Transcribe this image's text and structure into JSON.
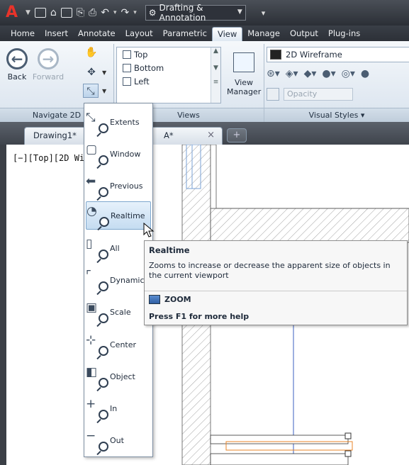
{
  "quick_access": {
    "workspace": "Drafting & Annotation"
  },
  "ribbon_tabs": [
    "Home",
    "Insert",
    "Annotate",
    "Layout",
    "Parametric",
    "View",
    "Manage",
    "Output",
    "Plug-ins"
  ],
  "navigate_panel": {
    "title": "Navigate 2D",
    "back_label": "Back",
    "forward_label": "Forward"
  },
  "views_panel": {
    "title": "Views",
    "items": [
      "Top",
      "Bottom",
      "Left"
    ],
    "view_manager_label": "View Manager"
  },
  "visual_styles_panel": {
    "title": "Visual Styles",
    "current_style": "2D Wireframe",
    "opacity_placeholder": "Opacity"
  },
  "file_tabs": {
    "tab1": "Drawing1*",
    "tab2": "A*"
  },
  "viewport_label": "[−][Top][2D Wi",
  "zoom_menu": {
    "items": [
      "Extents",
      "Window",
      "Previous",
      "Realtime",
      "All",
      "Dynamic",
      "Scale",
      "Center",
      "Object",
      "In",
      "Out"
    ],
    "highlighted": "Realtime"
  },
  "tooltip": {
    "title": "Realtime",
    "description": "Zooms to increase or decrease the apparent size of objects in the current viewport",
    "command": "ZOOM",
    "help": "Press F1 for more help"
  },
  "colors": {
    "accent_blue": "#7ea7cd",
    "dark_chrome": "#2b2f36",
    "highlight_orange": "#e8862a"
  }
}
